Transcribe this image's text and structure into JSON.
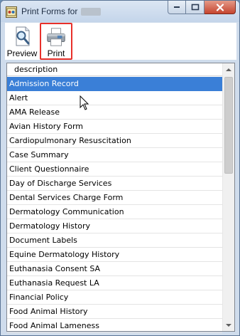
{
  "window": {
    "title": "Print Forms for",
    "accent_title_bg": "#c4d5ea",
    "close_color": "#c5452f"
  },
  "toolbar": {
    "preview_label": "Preview",
    "print_label": "Print",
    "highlight_color": "#e8302a"
  },
  "list": {
    "column_header": "description",
    "selected_color": "#3a7fd7",
    "items": [
      "Admission Record",
      "Alert",
      "AMA Release",
      "Avian History Form",
      "Cardiopulmonary Resuscitation",
      "Case Summary",
      "Client Questionnaire",
      "Day of Discharge Services",
      "Dental Services Charge Form",
      "Dermatology Communication",
      "Dermatology History",
      "Document Labels",
      "Equine Dermatology History",
      "Euthanasia Consent SA",
      "Euthanasia Request LA",
      "Financial Policy",
      "Food Animal History",
      "Food Animal Lameness"
    ],
    "selected_index": 0
  }
}
